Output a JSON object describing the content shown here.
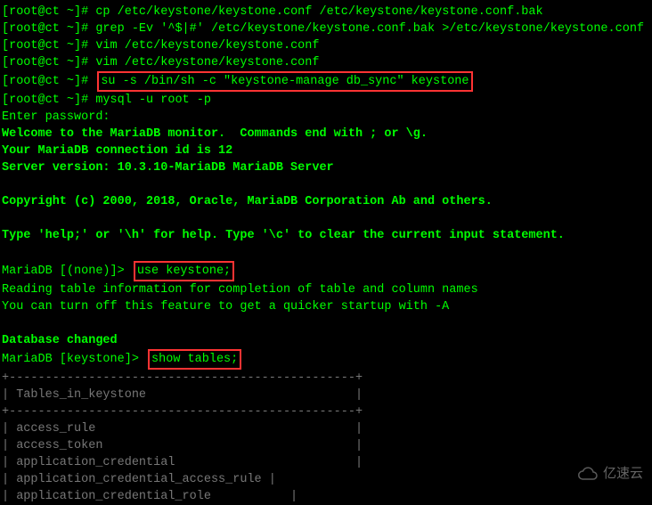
{
  "prompt": "[root@ct ~]# ",
  "mariadb_none": "MariaDB [(none)]> ",
  "mariadb_keystone": "MariaDB [keystone]> ",
  "cmd": {
    "cp": "cp /etc/keystone/keystone.conf /etc/keystone/keystone.conf.bak",
    "grep": "grep -Ev '^$|#' /etc/keystone/keystone.conf.bak >/etc/keystone/keystone.conf",
    "vim1": "vim /etc/keystone/keystone.conf",
    "vim2": "vim /etc/keystone/keystone.conf",
    "su": "su -s /bin/sh -c \"keystone-manage db_sync\" keystone",
    "mysql": "mysql -u root -p",
    "use": "use keystone;",
    "show": "show tables;"
  },
  "out": {
    "enter_pw": "Enter password:",
    "welcome": "Welcome to the MariaDB monitor.  Commands end with ; or \\g.",
    "conn_id": "Your MariaDB connection id is 12",
    "server_ver": "Server version: 10.3.10-MariaDB MariaDB Server",
    "copyright": "Copyright (c) 2000, 2018, Oracle, MariaDB Corporation Ab and others.",
    "help": "Type 'help;' or '\\h' for help. Type '\\c' to clear the current input statement.",
    "reading": "Reading table information for completion of table and column names",
    "turnoff": "You can turn off this feature to get a quicker startup with -A",
    "db_changed": "Database changed"
  },
  "table": {
    "border": "+------------------------------------------------+",
    "header": "| Tables_in_keystone                             |",
    "rows": [
      "| access_rule                                    |",
      "| access_token                                   |",
      "| application_credential                         |",
      "| application_credential_access_rule |",
      "| application_credential_role           |"
    ]
  },
  "watermark": "亿速云"
}
